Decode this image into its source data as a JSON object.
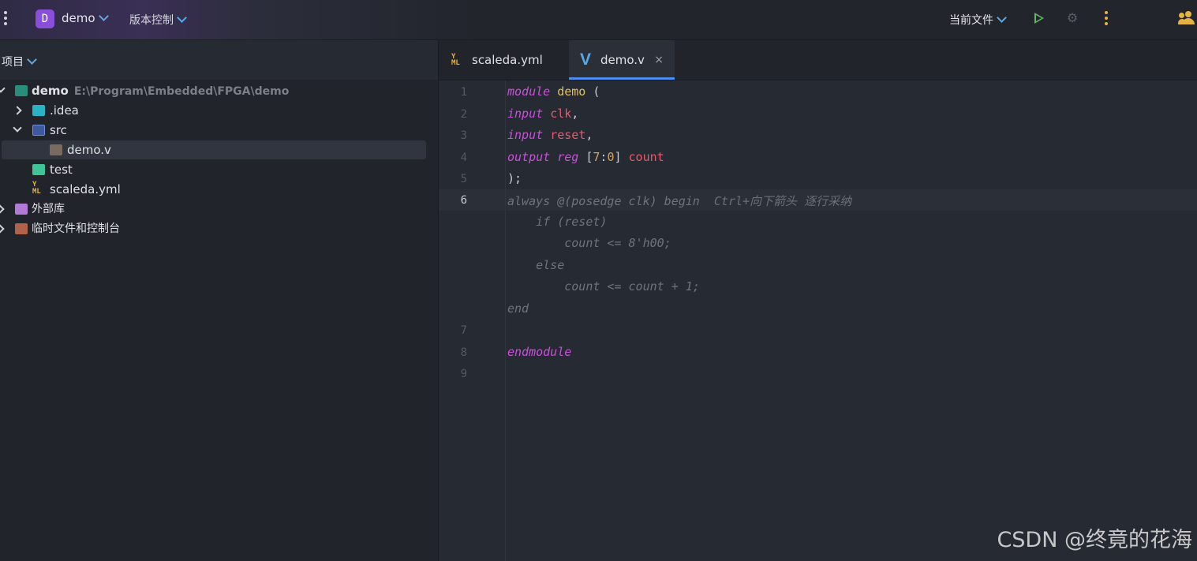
{
  "topbar": {
    "project_badge": "D",
    "project_name": "demo",
    "vcs_label": "版本控制",
    "run_config": "当前文件"
  },
  "panel": {
    "title": "项目",
    "tree": [
      {
        "label": "demo",
        "path": "E:\\Program\\Embedded\\FPGA\\demo",
        "icon": "module-folder-icon",
        "expanded": true
      },
      {
        "label": ".idea",
        "icon": "idea-folder-icon",
        "expanded": false
      },
      {
        "label": "src",
        "icon": "source-folder-icon",
        "expanded": true
      },
      {
        "label": "demo.v",
        "icon": "verilog-file-icon",
        "selected": true
      },
      {
        "label": "test",
        "icon": "test-folder-icon"
      },
      {
        "label": "scaleda.yml",
        "icon": "yaml-file-icon"
      },
      {
        "label": "外部库",
        "icon": "library-icon",
        "expanded": false
      },
      {
        "label": "临时文件和控制台",
        "icon": "scratches-icon",
        "expanded": false
      }
    ]
  },
  "tabs": [
    {
      "label": "scaleda.yml",
      "icon": "yaml-file-icon",
      "active": false
    },
    {
      "label": "demo.v",
      "icon": "verilog-file-icon",
      "active": true,
      "close": "×"
    }
  ],
  "editor": {
    "line_numbers": [
      "1",
      "2",
      "3",
      "4",
      "5",
      "6",
      "7",
      "8",
      "9"
    ],
    "lines": {
      "l1": {
        "kw": "module",
        "name": "demo",
        "rest": " ("
      },
      "l2": {
        "kw": "input",
        "port": "clk",
        "rest": ","
      },
      "l3": {
        "kw": "input",
        "port": "reset",
        "rest": ","
      },
      "l4": {
        "kw": "output",
        "kw2": "reg",
        "b1": " [",
        "n1": "7",
        "colon": ":",
        "n2": "0",
        "b2": "]",
        "port": "count"
      },
      "l5": {
        "text": ");"
      },
      "l6": {
        "ghost": "always @(posedge clk) begin",
        "hint": "Ctrl+向下箭头 逐行采纳"
      },
      "g1": "    if (reset)",
      "g2": "        count <= 8'h00;",
      "g3": "    else",
      "g4": "        count <= count + 1;",
      "g5": "end",
      "l8": {
        "kw": "endmodule"
      }
    }
  },
  "watermark": "CSDN @终竟的花海"
}
